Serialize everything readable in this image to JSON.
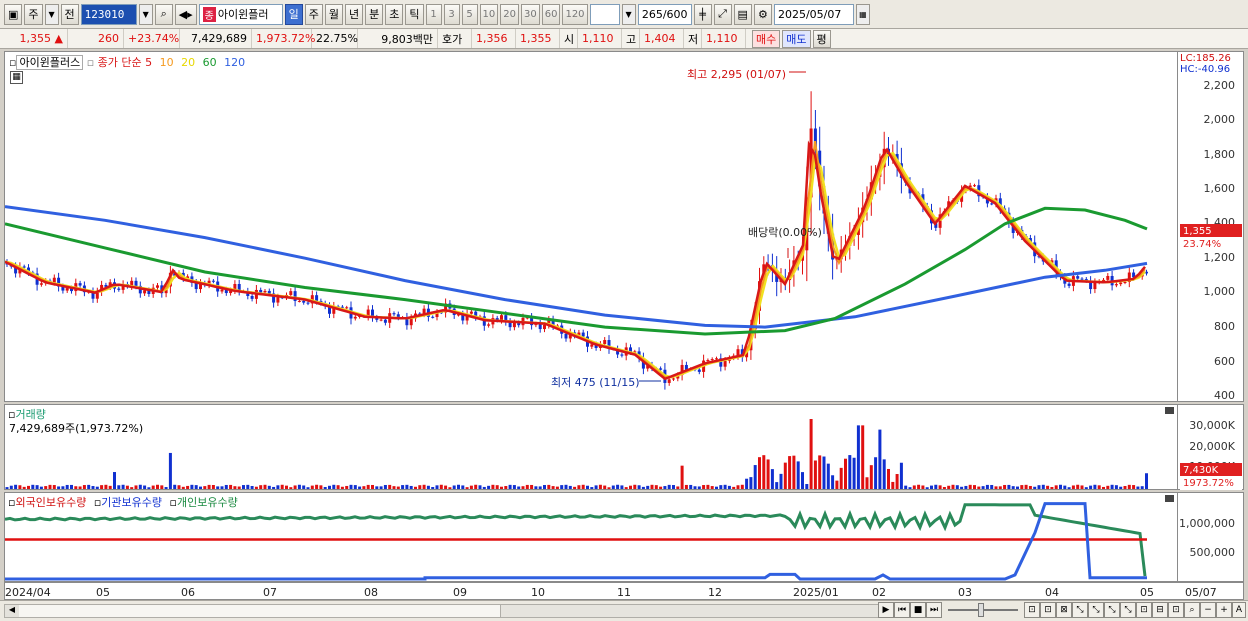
{
  "toolbar": {
    "type_label": "주",
    "prev_label": "전",
    "code": "123010",
    "stock_name_tag": "종",
    "stock_name": "아이윈플러",
    "periods": [
      "일",
      "주",
      "월",
      "년",
      "분",
      "초",
      "틱"
    ],
    "active_period": "일",
    "intervals": [
      "1",
      "3",
      "5",
      "10",
      "20",
      "30",
      "60",
      "120"
    ],
    "count_value": "265",
    "count_total": "/600",
    "date": "2025/05/07"
  },
  "quote": {
    "price": "1,355",
    "arrow": "▲",
    "change": "260",
    "change_pct": "+23.74%",
    "volume": "7,429,689",
    "volume_ratio": "1,973.72%",
    "turnover_pct": "22.75%",
    "amount": "9,803백만",
    "ask_label": "호가",
    "ask1": "1,356",
    "ask2": "1,355",
    "open_label": "시",
    "open": "1,110",
    "high_label": "고",
    "high": "1,404",
    "low_label": "저",
    "low": "1,110",
    "buy_label": "매수",
    "sell_label": "매도",
    "eval_label": "평"
  },
  "price_panel": {
    "title": "아이윈플러스",
    "ma_label": "종가 단순",
    "ma_periods": [
      "5",
      "10",
      "20",
      "60",
      "120"
    ],
    "lc": "LC:185.26",
    "hc": "HC:-40.96",
    "high_annotation": "최고 2,295 (01/07)",
    "low_annotation": "최저 475 (11/15)",
    "dividend_annotation": "배당락(0.00%)",
    "price_tag": "1,355",
    "pct_tag": "23.74%",
    "yticks": [
      "2,200",
      "2,000",
      "1,800",
      "1,600",
      "1,400",
      "1,200",
      "1,000",
      "800",
      "600",
      "400"
    ]
  },
  "volume_panel": {
    "title": "거래량",
    "value": "7,429,689주(1,973.72%)",
    "yticks": [
      "30,000K",
      "20,000K",
      "10,000K"
    ],
    "tag": "7,430K",
    "tag_pct": "1973.72%"
  },
  "holding_panel": {
    "foreign": "외국인보유수량",
    "inst": "기관보유수량",
    "indiv": "개인보유수량",
    "yticks": [
      "1,000,000",
      "500,000"
    ]
  },
  "xaxis": [
    "2024/04",
    "05",
    "06",
    "07",
    "08",
    "09",
    "10",
    "11",
    "12",
    "2025/01",
    "02",
    "03",
    "04",
    "05",
    "05/07"
  ],
  "colors": {
    "up": "#e01010",
    "down": "#1030d0",
    "ma5": "#d81818",
    "ma10": "#f59a20",
    "ma20": "#f0e020",
    "ma60": "#1a9a30",
    "ma120": "#3060e0"
  }
}
